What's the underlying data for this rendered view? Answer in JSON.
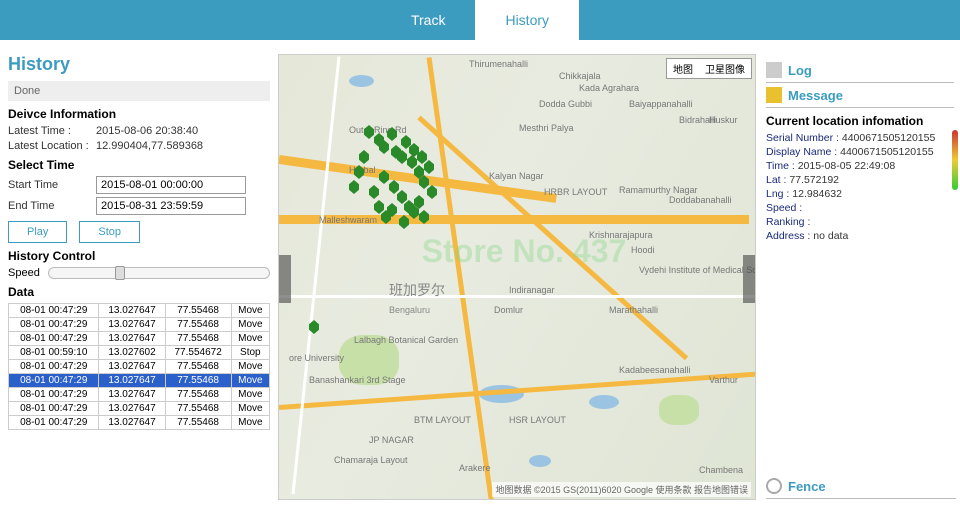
{
  "topbar": {
    "track": "Track",
    "history": "History"
  },
  "left": {
    "title": "History",
    "status": "Done",
    "device_hdr": "Deivce Information",
    "latest_time_lbl": "Latest Time :",
    "latest_time_val": "2015-08-06 20:38:40",
    "latest_loc_lbl": "Latest Location :",
    "latest_loc_val": "12.990404,77.589368",
    "select_hdr": "Select Time",
    "start_lbl": "Start Time",
    "start_val": "2015-08-01 00:00:00",
    "end_lbl": "End Time",
    "end_val": "2015-08-31 23:59:59",
    "play": "Play",
    "stop": "Stop",
    "hist_ctrl": "History Control",
    "speed_lbl": "Speed",
    "data_hdr": "Data",
    "rows": [
      {
        "t": "08-01 00:47:29",
        "lat": "13.027647",
        "lng": "77.55468",
        "a": "Move",
        "sel": false
      },
      {
        "t": "08-01 00:47:29",
        "lat": "13.027647",
        "lng": "77.55468",
        "a": "Move",
        "sel": false
      },
      {
        "t": "08-01 00:47:29",
        "lat": "13.027647",
        "lng": "77.55468",
        "a": "Move",
        "sel": false
      },
      {
        "t": "08-01 00:59:10",
        "lat": "13.027602",
        "lng": "77.554672",
        "a": "Stop",
        "sel": false
      },
      {
        "t": "08-01 00:47:29",
        "lat": "13.027647",
        "lng": "77.55468",
        "a": "Move",
        "sel": false
      },
      {
        "t": "08-01 00:47:29",
        "lat": "13.027647",
        "lng": "77.55468",
        "a": "Move",
        "sel": true
      },
      {
        "t": "08-01 00:47:29",
        "lat": "13.027647",
        "lng": "77.55468",
        "a": "Move",
        "sel": false
      },
      {
        "t": "08-01 00:47:29",
        "lat": "13.027647",
        "lng": "77.55468",
        "a": "Move",
        "sel": false
      },
      {
        "t": "08-01 00:47:29",
        "lat": "13.027647",
        "lng": "77.55468",
        "a": "Move",
        "sel": false
      }
    ]
  },
  "map": {
    "type_map": "地图",
    "type_sat": "卫星图像",
    "city": "班加罗尔",
    "city_en": "Bengaluru",
    "places": [
      "Thirumenahalli",
      "Chikkajala",
      "Kada Agrahara",
      "Dodda Gubbi",
      "Baiyappanahalli",
      "Bidrahalli",
      "Huskur",
      "Mesthri Palya",
      "Kalyan Nagar",
      "HRBR LAYOUT",
      "Ramamurthy Nagar",
      "Doddabanahalli",
      "Malleshwaram",
      "Krishnarajapura",
      "Hoodi",
      "Vydehi Institute of Medical Sciences &",
      "Indiranagar",
      "Domlur",
      "Marathahalli",
      "Lalbagh Botanical Garden",
      "ore University",
      "Banashankari 3rd Stage",
      "BTM LAYOUT",
      "HSR LAYOUT",
      "Kadabeesanahalli",
      "Varthur",
      "Chamaraja Layout",
      "Arakere",
      "JP NAGAR",
      "Chambena",
      "Outer Ring Rd",
      "Herbal"
    ],
    "watermark": "Store No. 437",
    "attr": "地图数据 ©2015 GS(2011)6020 Google   使用条款   报告地图错误"
  },
  "right": {
    "log": "Log",
    "msg": "Message",
    "info_hdr": "Current location infomation",
    "serial_k": "Serial Number :",
    "serial_v": "4400671505120155",
    "disp_k": "Display Name :",
    "disp_v": "4400671505120155",
    "time_k": "Time :",
    "time_v": "2015-08-05 22:49:08",
    "lat_k": "Lat :",
    "lat_v": "77.572192",
    "lng_k": "Lng :",
    "lng_v": "12.984632",
    "speed_k": "Speed :",
    "speed_v": "",
    "rank_k": "Ranking :",
    "rank_v": "",
    "addr_k": "Address :",
    "addr_v": "no data",
    "fence": "Fence"
  }
}
